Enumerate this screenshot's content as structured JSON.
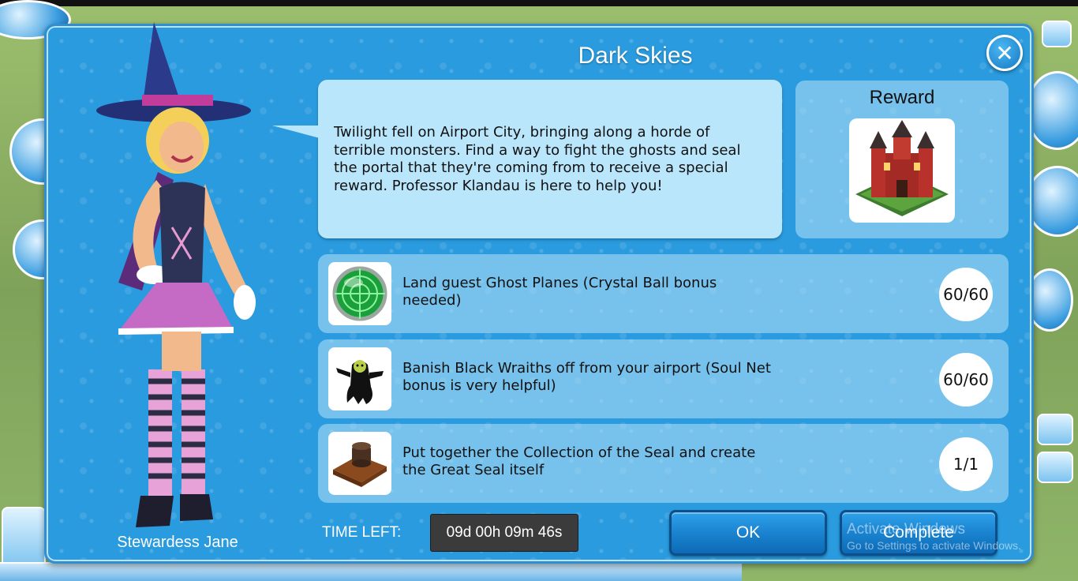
{
  "dialog": {
    "title": "Dark Skies",
    "close_icon": "close-icon",
    "character_name": "Stewardess Jane",
    "description": "Twilight fell on Airport City, bringing along a horde of terrible monsters. Find a way to fight the ghosts and seal the portal that they're coming from to receive a special reward. Professor Klandau is here to help you!",
    "reward_label": "Reward",
    "reward_icon": "castle-icon"
  },
  "quests": [
    {
      "icon": "crystal-ball-radar-icon",
      "text": "Land guest Ghost Planes (Crystal Ball bonus needed)",
      "progress": "60/60"
    },
    {
      "icon": "black-wraith-icon",
      "text": "Banish Black Wraiths off from your airport (Soul Net bonus is very helpful)",
      "progress": "60/60"
    },
    {
      "icon": "great-seal-icon",
      "text": "Put together the Collection of the Seal and create the Great Seal itself",
      "progress": "1/1"
    }
  ],
  "footer": {
    "time_left_label": "TIME LEFT:",
    "time_left_value": "09d 00h 09m 46s",
    "ok_label": "OK",
    "complete_label": "Complete"
  },
  "watermark": {
    "title": "Activate Windows",
    "subtitle": "Go to Settings to activate Windows."
  },
  "colors": {
    "dialog_bg": "#2a9bde",
    "bubble_bg": "#b9e6fb",
    "button_blue": "#1a83d0"
  }
}
